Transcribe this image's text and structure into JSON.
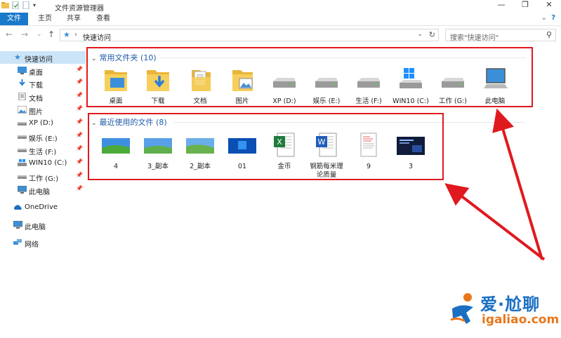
{
  "window": {
    "title": "文件资源管理器",
    "controls": [
      "—",
      "❐",
      "✕"
    ]
  },
  "ribbon": {
    "tabs": [
      "文件",
      "主页",
      "共享",
      "查看"
    ],
    "active": "文件"
  },
  "address": {
    "path": "快速访问",
    "search_placeholder": "搜索\"快速访问\""
  },
  "sidebar": {
    "items": [
      {
        "label": "快速访问",
        "icon": "star-icon",
        "pinned": false,
        "selected": true
      },
      {
        "label": "桌面",
        "icon": "desktop-icon",
        "pinned": true
      },
      {
        "label": "下载",
        "icon": "download-icon",
        "pinned": true
      },
      {
        "label": "文档",
        "icon": "document-icon",
        "pinned": true
      },
      {
        "label": "图片",
        "icon": "picture-icon",
        "pinned": true
      },
      {
        "label": "XP (D:)",
        "icon": "drive-icon",
        "pinned": true
      },
      {
        "label": "娱乐 (E:)",
        "icon": "drive-icon",
        "pinned": true
      },
      {
        "label": "生活 (F:)",
        "icon": "drive-icon",
        "pinned": true
      },
      {
        "label": "WIN10 (C:)",
        "icon": "windows-drive-icon",
        "pinned": true
      },
      {
        "label": "工作 (G:)",
        "icon": "drive-icon",
        "pinned": true
      },
      {
        "label": "此电脑",
        "icon": "computer-icon",
        "pinned": true
      },
      {
        "label": "OneDrive",
        "icon": "cloud-icon",
        "pinned": false
      },
      {
        "label": "此电脑",
        "icon": "computer-icon",
        "pinned": false
      },
      {
        "label": "网络",
        "icon": "network-icon",
        "pinned": false
      }
    ]
  },
  "frequent": {
    "header": "常用文件夹 (10)",
    "items": [
      {
        "label": "桌面",
        "icon": "desktop-folder-icon"
      },
      {
        "label": "下载",
        "icon": "download-folder-icon"
      },
      {
        "label": "文档",
        "icon": "document-folder-icon"
      },
      {
        "label": "图片",
        "icon": "picture-folder-icon"
      },
      {
        "label": "XP (D:)",
        "icon": "drive-icon"
      },
      {
        "label": "娱乐 (E:)",
        "icon": "drive-icon"
      },
      {
        "label": "生活 (F:)",
        "icon": "drive-icon"
      },
      {
        "label": "WIN10 (C:)",
        "icon": "windows-drive-icon"
      },
      {
        "label": "工作 (G:)",
        "icon": "drive-icon"
      },
      {
        "label": "此电脑",
        "icon": "computer-icon"
      }
    ]
  },
  "recent": {
    "header": "最近使用的文件 (8)",
    "items": [
      {
        "label": "4",
        "icon": "image-thumb-icon"
      },
      {
        "label": "3_副本",
        "icon": "image-thumb-icon"
      },
      {
        "label": "2_副本",
        "icon": "image-thumb-icon"
      },
      {
        "label": "01",
        "icon": "image-thumb-icon"
      },
      {
        "label": "金币",
        "icon": "excel-file-icon"
      },
      {
        "label": "钢筋每米理论质量",
        "icon": "word-file-icon"
      },
      {
        "label": "9",
        "icon": "document-thumb-icon"
      },
      {
        "label": "3",
        "icon": "dark-image-thumb-icon"
      }
    ]
  },
  "watermark": {
    "brand": "爱·尬聊",
    "url": "igaliao.com"
  },
  "colors": {
    "accent": "#1979ca",
    "annotation": "#e0191f",
    "group_header": "#1e5aa8",
    "folder": "#f0c350"
  }
}
